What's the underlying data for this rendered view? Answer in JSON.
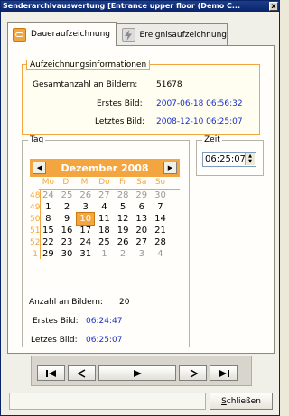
{
  "window": {
    "title": "Senderarchivauswertung [Entrance upper floor (Demo C...",
    "close_glyph": "x"
  },
  "tabs": [
    {
      "label": "Daueraufzeichnung",
      "icon": "recording-icon"
    },
    {
      "label": "Ereignisaufzeichnung",
      "icon": "lightning-icon"
    }
  ],
  "info": {
    "group_title": "Aufzeichnungsinformationen",
    "total_label": "Gesamtanzahl an Bildern:",
    "total_value": "51678",
    "first_label": "Erstes Bild:",
    "first_value": "2007-06-18 06:56:32",
    "last_label": "Letztes Bild:",
    "last_value": "2008-12-10 06:25:07"
  },
  "tag": {
    "group_title": "Tag",
    "calendar": {
      "month_title": "Dezember 2008",
      "prev_glyph": "◀",
      "next_glyph": "▶",
      "day_names": [
        "Mo",
        "Di",
        "Mi",
        "Do",
        "Fr",
        "Sa",
        "So"
      ],
      "weeks": [
        {
          "week": "48",
          "days": [
            "24",
            "25",
            "26",
            "27",
            "28",
            "29",
            "30"
          ]
        },
        {
          "week": "49",
          "days": [
            "1",
            "2",
            "3",
            "4",
            "5",
            "6",
            "7"
          ]
        },
        {
          "week": "50",
          "days": [
            "8",
            "9",
            "10",
            "11",
            "12",
            "13",
            "14"
          ]
        },
        {
          "week": "51",
          "days": [
            "15",
            "16",
            "17",
            "18",
            "19",
            "20",
            "21"
          ]
        },
        {
          "week": "52",
          "days": [
            "22",
            "23",
            "24",
            "25",
            "26",
            "27",
            "28"
          ]
        },
        {
          "week": "1",
          "days": [
            "29",
            "30",
            "31",
            "1",
            "2",
            "3",
            "4"
          ]
        }
      ],
      "selected_day": "10",
      "accent_color": "#f3a640"
    },
    "count_label": "Anzahl an Bildern:",
    "count_value": "20",
    "first_label": "Erstes Bild:",
    "first_value": "06:24:47",
    "last_label": "Letzes Bild:",
    "last_value": "06:25:07"
  },
  "zeit": {
    "group_title": "Zeit",
    "time_value": "06:25:07",
    "spin_up": "▲",
    "spin_down": "▼"
  },
  "playback": {
    "buttons": [
      "skip-to-start-icon",
      "step-back-icon",
      "play-icon",
      "step-forward-icon",
      "skip-to-end-icon"
    ]
  },
  "footer": {
    "close_label_prefix": "S",
    "close_label_rest": "chließen"
  }
}
